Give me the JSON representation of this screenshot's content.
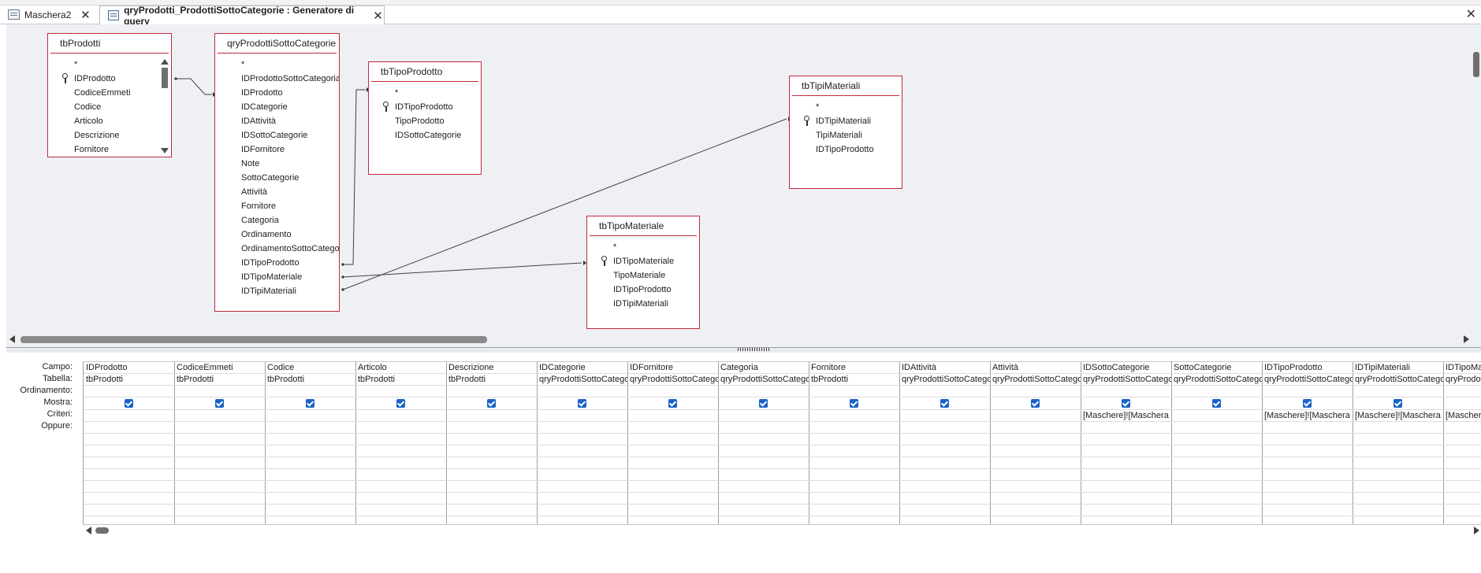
{
  "tabs": [
    {
      "label": "Maschera2"
    },
    {
      "label": "qryProdotti_ProdottiSottoCategorie : Generatore di query"
    }
  ],
  "icons": {
    "close": "close-icon",
    "form": "form-icon",
    "query": "query-icon",
    "key": "key-icon"
  },
  "colors": {
    "table_border": "#c0283c",
    "pane_bg": "#eef0f4",
    "checkbox": "#1a62c9"
  },
  "tables": [
    {
      "name": "tbProdotti",
      "fields": [
        {
          "name": "*"
        },
        {
          "name": "IDProdotto",
          "key": true
        },
        {
          "name": "CodiceEmmeti"
        },
        {
          "name": "Codice"
        },
        {
          "name": "Articolo"
        },
        {
          "name": "Descrizione"
        },
        {
          "name": "Fornitore"
        }
      ]
    },
    {
      "name": "qryProdottiSottoCategorie",
      "fields": [
        {
          "name": "*"
        },
        {
          "name": "IDProdottoSottoCategoria"
        },
        {
          "name": "IDProdotto"
        },
        {
          "name": "IDCategorie"
        },
        {
          "name": "IDAttività"
        },
        {
          "name": "IDSottoCategorie"
        },
        {
          "name": "IDFornitore"
        },
        {
          "name": "Note"
        },
        {
          "name": "SottoCategorie"
        },
        {
          "name": "Attività"
        },
        {
          "name": "Fornitore"
        },
        {
          "name": "Categoria"
        },
        {
          "name": "Ordinamento"
        },
        {
          "name": "OrdinamentoSottoCategorie"
        },
        {
          "name": "IDTipoProdotto"
        },
        {
          "name": "IDTipoMateriale"
        },
        {
          "name": "IDTipiMateriali"
        }
      ]
    },
    {
      "name": "tbTipoProdotto",
      "fields": [
        {
          "name": "*"
        },
        {
          "name": "IDTipoProdotto",
          "key": true
        },
        {
          "name": "TipoProdotto"
        },
        {
          "name": "IDSottoCategorie"
        }
      ]
    },
    {
      "name": "tbTipoMateriale",
      "fields": [
        {
          "name": "*"
        },
        {
          "name": "IDTipoMateriale",
          "key": true
        },
        {
          "name": "TipoMateriale"
        },
        {
          "name": "IDTipoProdotto"
        },
        {
          "name": "IDTipiMateriali"
        }
      ]
    },
    {
      "name": "tbTipiMateriali",
      "fields": [
        {
          "name": "*"
        },
        {
          "name": "IDTipiMateriali",
          "key": true
        },
        {
          "name": "TipiMateriali"
        },
        {
          "name": "IDTipoProdotto"
        }
      ]
    }
  ],
  "grid": {
    "row_labels": [
      "Campo:",
      "Tabella:",
      "Ordinamento:",
      "Mostra:",
      "Criteri:",
      "Oppure:"
    ],
    "columns": [
      {
        "campo": "IDProdotto",
        "tabella": "tbProdotti",
        "mostra": true,
        "criteri": ""
      },
      {
        "campo": "CodiceEmmeti",
        "tabella": "tbProdotti",
        "mostra": true,
        "criteri": ""
      },
      {
        "campo": "Codice",
        "tabella": "tbProdotti",
        "mostra": true,
        "criteri": ""
      },
      {
        "campo": "Articolo",
        "tabella": "tbProdotti",
        "mostra": true,
        "criteri": ""
      },
      {
        "campo": "Descrizione",
        "tabella": "tbProdotti",
        "mostra": true,
        "criteri": ""
      },
      {
        "campo": "IDCategorie",
        "tabella": "qryProdottiSottoCategorie",
        "mostra": true,
        "criteri": ""
      },
      {
        "campo": "IDFornitore",
        "tabella": "qryProdottiSottoCategorie",
        "mostra": true,
        "criteri": ""
      },
      {
        "campo": "Categoria",
        "tabella": "qryProdottiSottoCategorie",
        "mostra": true,
        "criteri": ""
      },
      {
        "campo": "Fornitore",
        "tabella": "tbProdotti",
        "mostra": true,
        "criteri": ""
      },
      {
        "campo": "IDAttività",
        "tabella": "qryProdottiSottoCategorie",
        "mostra": true,
        "criteri": ""
      },
      {
        "campo": "Attività",
        "tabella": "qryProdottiSottoCategorie",
        "mostra": true,
        "criteri": ""
      },
      {
        "campo": "IDSottoCategorie",
        "tabella": "qryProdottiSottoCategorie",
        "mostra": true,
        "criteri": "[Maschere]![Maschera"
      },
      {
        "campo": "SottoCategorie",
        "tabella": "qryProdottiSottoCategorie",
        "mostra": true,
        "criteri": ""
      },
      {
        "campo": "IDTipoProdotto",
        "tabella": "qryProdottiSottoCategorie",
        "mostra": true,
        "criteri": "[Maschere]![Maschera"
      },
      {
        "campo": "IDTipiMateriali",
        "tabella": "qryProdottiSottoCategorie",
        "mostra": true,
        "criteri": "[Maschere]![Maschera"
      },
      {
        "campo": "IDTipoMateriale",
        "tabella": "qryProdottiSottoCategorie",
        "mostra": true,
        "criteri": "[Maschere]![Maschera"
      }
    ]
  }
}
